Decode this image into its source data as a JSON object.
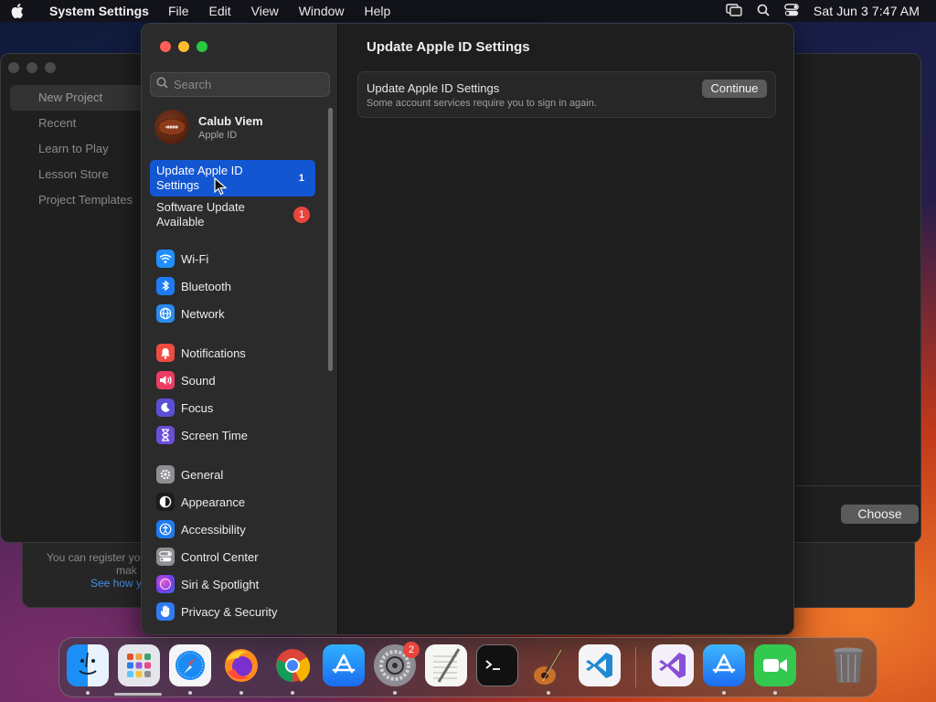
{
  "menubar": {
    "app_name": "System Settings",
    "menus": [
      "File",
      "Edit",
      "View",
      "Window",
      "Help"
    ],
    "clock": "Sat Jun 3  7:47 AM"
  },
  "background_window": {
    "sidebar_items": [
      "New Project",
      "Recent",
      "Learn to Play",
      "Lesson Store",
      "Project Templates"
    ],
    "choose_label": "Choose",
    "footer_line1": "You can register yo",
    "footer_line2": "mak",
    "footer_link": "See how y"
  },
  "settings": {
    "search_placeholder": "Search",
    "account": {
      "name": "Calub Viem",
      "subtitle": "Apple ID"
    },
    "alerts": [
      {
        "label": "Update Apple ID Settings",
        "count": "1"
      },
      {
        "label": "Software Update Available",
        "count": "1"
      }
    ],
    "nav": [
      {
        "label": "Wi-Fi",
        "icon": "wifi-icon",
        "color": "#1e90ff"
      },
      {
        "label": "Bluetooth",
        "icon": "bluetooth-icon",
        "color": "#1e7cf2"
      },
      {
        "label": "Network",
        "icon": "globe-icon",
        "color": "#2a8cf0"
      },
      {
        "label": "Notifications",
        "icon": "bell-icon",
        "color": "#ef4b3f"
      },
      {
        "label": "Sound",
        "icon": "speaker-icon",
        "color": "#ee3b62"
      },
      {
        "label": "Focus",
        "icon": "moon-icon",
        "color": "#5b4fd6"
      },
      {
        "label": "Screen Time",
        "icon": "hourglass-icon",
        "color": "#6a4fd8"
      },
      {
        "label": "General",
        "icon": "gear-icon",
        "color": "#8e8e93"
      },
      {
        "label": "Appearance",
        "icon": "appearance-icon",
        "color": "#1c1c1e"
      },
      {
        "label": "Accessibility",
        "icon": "accessibility-icon",
        "color": "#1e7cf2"
      },
      {
        "label": "Control Center",
        "icon": "control-center-icon",
        "color": "#8e8e93"
      },
      {
        "label": "Siri & Spotlight",
        "icon": "siri-icon",
        "color": "#b04ad8"
      },
      {
        "label": "Privacy & Security",
        "icon": "hand-icon",
        "color": "#2f7cf0"
      }
    ],
    "content": {
      "title": "Update Apple ID Settings",
      "card_title": "Update Apple ID Settings",
      "card_desc": "Some account services require you to sign in again.",
      "continue_label": "Continue"
    }
  },
  "dock": {
    "apps": [
      "finder-icon",
      "launchpad-icon",
      "safari-icon",
      "firefox-icon",
      "chrome-icon",
      "app-store-icon",
      "system-settings-icon",
      "textedit-icon",
      "terminal-icon",
      "garageband-icon",
      "vscode-icon",
      "visual-studio-icon",
      "xcode-app-store-icon",
      "facetime-icon",
      "trash-icon"
    ],
    "settings_badge": "2"
  }
}
